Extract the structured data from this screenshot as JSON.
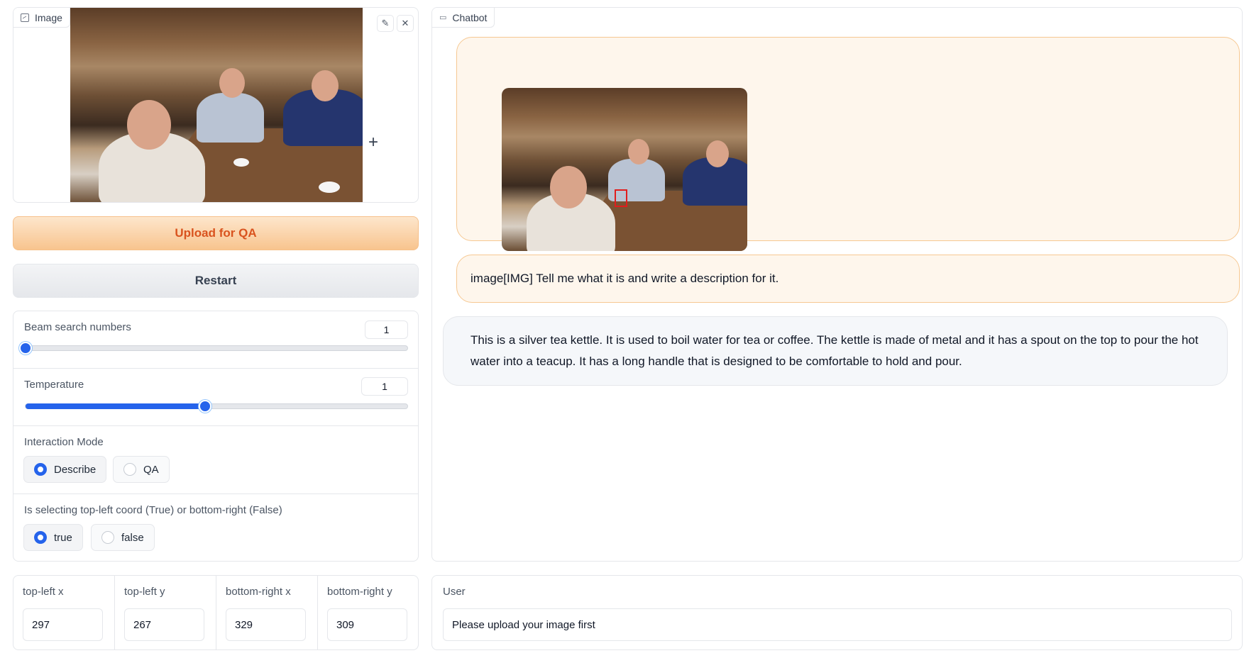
{
  "image_component": {
    "label": "Image",
    "icon": "image-icon",
    "edit_icon": "pencil-icon",
    "close_icon": "close-icon",
    "add_icon": "plus-icon"
  },
  "buttons": {
    "upload_label": "Upload for QA",
    "restart_label": "Restart"
  },
  "settings": {
    "beam": {
      "label": "Beam search numbers",
      "value": "1",
      "fraction": 0.0
    },
    "temperature": {
      "label": "Temperature",
      "value": "1",
      "fraction": 0.47
    },
    "interaction_mode": {
      "label": "Interaction Mode",
      "options": [
        "Describe",
        "QA"
      ],
      "selected": "Describe"
    },
    "coord_select": {
      "label": "Is selecting top-left coord (True) or bottom-right (False)",
      "options": [
        "true",
        "false"
      ],
      "selected": "true"
    }
  },
  "coords": [
    {
      "label": "top-left x",
      "value": "297"
    },
    {
      "label": "top-left y",
      "value": "267"
    },
    {
      "label": "bottom-right x",
      "value": "329"
    },
    {
      "label": "bottom-right y",
      "value": "309"
    }
  ],
  "chatbot": {
    "label": "Chatbot",
    "icon": "chat-icon",
    "messages": [
      {
        "role": "user",
        "type": "image"
      },
      {
        "role": "user",
        "text": "image[IMG] Tell me what it is and write a description for it."
      },
      {
        "role": "bot",
        "text": "This is a silver tea kettle. It is used to boil water for tea or coffee. The kettle is made of metal and it has a spout on the top to pour the hot water into a teacup. It has a long handle that is designed to be comfortable to hold and pour."
      }
    ]
  },
  "user_input": {
    "label": "User",
    "value": "Please upload your image first"
  },
  "colors": {
    "accent": "#2563eb",
    "upload_text": "#d9531e",
    "user_bubble": "#fef6ec",
    "user_bubble_border": "#f6c892",
    "bbox": "#e11d1d"
  }
}
